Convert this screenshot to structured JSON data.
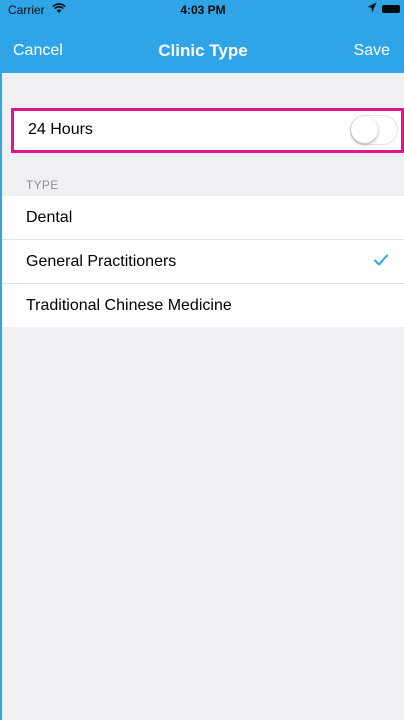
{
  "status_bar": {
    "carrier": "Carrier",
    "time": "4:03 PM"
  },
  "nav": {
    "cancel_label": "Cancel",
    "title": "Clinic Type",
    "save_label": "Save"
  },
  "hours_row": {
    "label": "24 Hours",
    "toggle_on": false
  },
  "type_section": {
    "header": "TYPE",
    "items": [
      {
        "label": "Dental",
        "selected": false
      },
      {
        "label": "General Practitioners",
        "selected": true
      },
      {
        "label": "Traditional Chinese Medicine",
        "selected": false
      }
    ]
  },
  "colors": {
    "accent": "#2fa4e7",
    "highlight": "#e0158b",
    "background": "#efeff4"
  },
  "icons": [
    "wifi-icon",
    "location-icon",
    "battery-icon",
    "checkmark-icon"
  ]
}
